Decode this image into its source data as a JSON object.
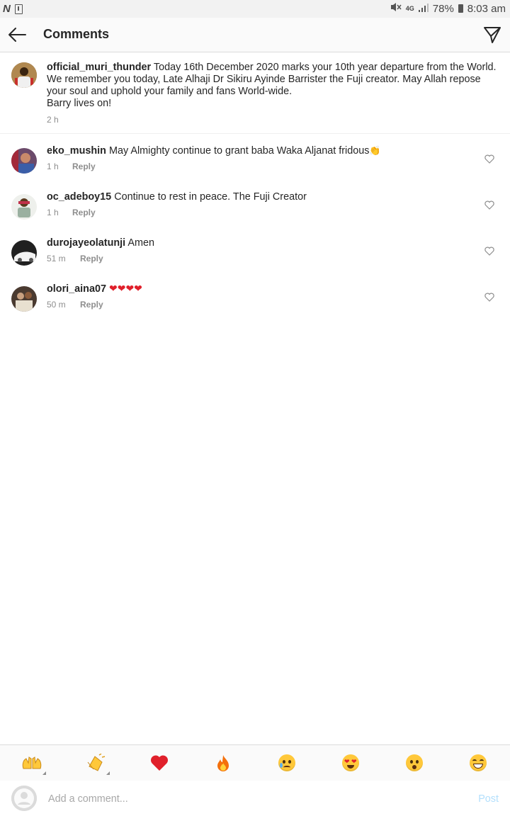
{
  "status_bar": {
    "network_letter": "N",
    "signal_label": "4G",
    "battery": "78%",
    "time": "8:03 am"
  },
  "header": {
    "title": "Comments"
  },
  "caption": {
    "username": "official_muri_thunder",
    "text": "Today 16th December 2020 marks your 10th year departure from the World. We remember you today, Late Alhaji Dr Sikiru Ayinde Barrister the Fuji creator. May Allah repose your soul and uphold your family and fans World-wide.",
    "text_line2": "Barry lives on!",
    "time": "2 h"
  },
  "comments": [
    {
      "username": "eko_mushin",
      "text": "May Almighty continue to grant baba Waka Aljanat fridous",
      "emoji": "👏",
      "time": "1 h",
      "reply": "Reply"
    },
    {
      "username": "oc_adeboy15",
      "text": "Continue to rest in peace. The Fuji Creator",
      "emoji": "",
      "time": "1 h",
      "reply": "Reply"
    },
    {
      "username": "durojayeolatunji",
      "text": "Amen",
      "emoji": "",
      "time": "51 m",
      "reply": "Reply"
    },
    {
      "username": "olori_aina07",
      "text": "",
      "emoji": "❤❤❤❤",
      "time": "50 m",
      "reply": "Reply"
    }
  ],
  "emoji_bar": [
    "raised-hands",
    "clapping-hands",
    "red-heart",
    "fire",
    "crying-face",
    "heart-eyes-face",
    "surprised-face",
    "laughing-face"
  ],
  "input": {
    "placeholder": "Add a comment...",
    "post_label": "Post"
  },
  "colors": {
    "link_blue": "#b2dffc",
    "heart_red": "#e0202b",
    "muted_gray": "#8e8e8e"
  }
}
